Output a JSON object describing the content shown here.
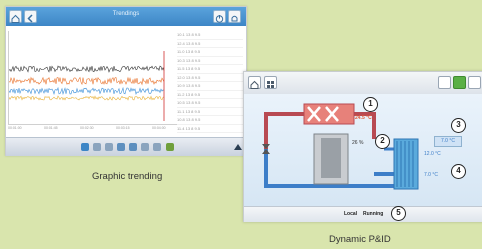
{
  "trending_screen": {
    "title": "Trendings",
    "table_rows": [
      "  10.1  13  8  9.5",
      "  12.4  13  8  9.5",
      "  11.0  13  8  9.5",
      "  10.3  13  8  9.5",
      "  11.5  13  8  9.5",
      "  12.0  13  8  9.5",
      "  10.9  13  8  9.5",
      "  11.2  13  8  9.5",
      "  10.5  13  8  9.5",
      "  11.1  13  8  9.5",
      "  10.8  13  8  9.5",
      "  11.4  13  8  9.5"
    ],
    "x_ticks": [
      "00:01:00",
      "00:01:45",
      "00:02:30",
      "00:03:15",
      "00:04:00"
    ],
    "series_colors": [
      "#333333",
      "#e8712a",
      "#3b8fd8",
      "#e8b23a"
    ]
  },
  "pid_screen": {
    "status_local": "Local",
    "status_running": "Running",
    "callouts": [
      "1",
      "2",
      "3",
      "4",
      "5"
    ],
    "values": {
      "condenser_temp": "24.5 °C",
      "compressor_pct": "26 %",
      "setpoint": "7.0 °C",
      "evap_in": "12.0 °C",
      "evap_out": "7.0 °C"
    }
  },
  "captions": {
    "left": "Graphic trending",
    "right": "Dynamic P&ID"
  }
}
